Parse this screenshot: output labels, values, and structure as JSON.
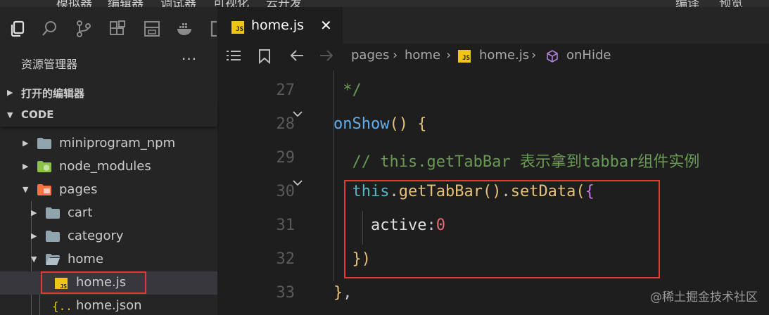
{
  "menubar": {
    "items": [
      "模拟器",
      "编辑器",
      "调试器",
      "可视化",
      "云开发",
      "编译",
      "预览"
    ]
  },
  "activity_bar": {
    "icons": [
      "files-icon",
      "search-icon",
      "source-control-icon",
      "extensions-icon",
      "layout-icon",
      "docker-icon"
    ]
  },
  "explorer": {
    "title": "资源管理器",
    "more": "···",
    "sections": {
      "open_editors": "打开的编辑器",
      "code": "CODE"
    },
    "tree": [
      {
        "label": "miniprogram_npm",
        "kind": "folder",
        "expanded": false
      },
      {
        "label": "node_modules",
        "kind": "node-folder",
        "expanded": false
      },
      {
        "label": "pages",
        "kind": "pages-folder",
        "expanded": true
      },
      {
        "label": "cart",
        "kind": "folder",
        "expanded": false
      },
      {
        "label": "category",
        "kind": "folder",
        "expanded": false
      },
      {
        "label": "home",
        "kind": "folder-open",
        "expanded": true
      },
      {
        "label": "home.js",
        "kind": "js-file",
        "selected": true
      },
      {
        "label": "home.json",
        "kind": "json-file"
      }
    ]
  },
  "editor": {
    "tab": {
      "label": "home.js",
      "badge": "JS",
      "close": "✕"
    },
    "breadcrumb": [
      "pages",
      "home",
      "home.js",
      "onHide"
    ],
    "breadcrumb_sep": "›",
    "lines": [
      {
        "number": "27",
        "text": " */"
      },
      {
        "number": "28",
        "text": "onShow() {"
      },
      {
        "number": "29",
        "text": "  // this.getTabBar 表示拿到tabbar组件实例"
      },
      {
        "number": "30",
        "text": "  this.getTabBar().setData({"
      },
      {
        "number": "31",
        "text": "    active:0"
      },
      {
        "number": "32",
        "text": "  })"
      },
      {
        "number": "33",
        "text": "},"
      }
    ]
  },
  "watermark": "@稀土掘金技术社区",
  "colors": {
    "highlight_box": "#e53935",
    "js_badge": "#f0c419"
  }
}
